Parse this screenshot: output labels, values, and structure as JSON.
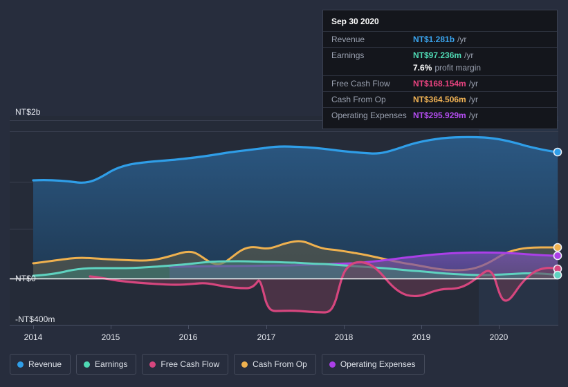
{
  "axis": {
    "y_top_label": "NT$2b",
    "y_zero_label": "NT$0",
    "y_bottom_label": "-NT$400m",
    "x_ticks": [
      "2014",
      "2015",
      "2016",
      "2017",
      "2018",
      "2019",
      "2020"
    ]
  },
  "tooltip": {
    "date": "Sep 30 2020",
    "rows": [
      {
        "label": "Revenue",
        "value": "NT$1.281b",
        "unit": "/yr",
        "color": "#3aa4ee"
      },
      {
        "label": "Earnings",
        "value": "NT$97.236m",
        "unit": "/yr",
        "color": "#4fd9b4"
      },
      {
        "label": "",
        "value": "7.6%",
        "unit": "profit margin",
        "color": "#ffffff"
      },
      {
        "label": "Free Cash Flow",
        "value": "NT$168.154m",
        "unit": "/yr",
        "color": "#e8437f"
      },
      {
        "label": "Cash From Op",
        "value": "NT$364.506m",
        "unit": "/yr",
        "color": "#f0b254"
      },
      {
        "label": "Operating Expenses",
        "value": "NT$295.929m",
        "unit": "/yr",
        "color": "#b44df0"
      }
    ]
  },
  "legend": {
    "items": [
      {
        "label": "Revenue",
        "color": "#2f9ee8"
      },
      {
        "label": "Earnings",
        "color": "#4fd9b4"
      },
      {
        "label": "Free Cash Flow",
        "color": "#d6467e"
      },
      {
        "label": "Cash From Op",
        "color": "#efb14f"
      },
      {
        "label": "Operating Expenses",
        "color": "#ab3fe8"
      }
    ]
  },
  "colors": {
    "background": "#272d3d",
    "plot_background": "#252b38",
    "gridline": "#3a4050",
    "zero_line": "#ffffff"
  },
  "chart_data": {
    "type": "area",
    "title": "",
    "xlabel": "",
    "ylabel": "",
    "ylim": [
      -400,
      2000
    ],
    "y_unit": "NT$ millions",
    "x": [
      "2014",
      "2014.25",
      "2014.5",
      "2014.75",
      "2015",
      "2015.25",
      "2015.5",
      "2015.75",
      "2016",
      "2016.25",
      "2016.5",
      "2016.75",
      "2017",
      "2017.25",
      "2017.5",
      "2017.75",
      "2018",
      "2018.25",
      "2018.5",
      "2018.75",
      "2019",
      "2019.25",
      "2019.5",
      "2019.75",
      "2020",
      "2020.25",
      "2020.5",
      "2020.75"
    ],
    "grid": true,
    "legend_position": "bottom",
    "series": [
      {
        "name": "Revenue",
        "color": "#2f9ee8",
        "fill": "#22405e",
        "values": [
          1175,
          1180,
          1160,
          1120,
          1130,
          1190,
          1250,
          1290,
          1300,
          1300,
          1310,
          1320,
          1360,
          1390,
          1390,
          1370,
          1385,
          1390,
          1380,
          1360,
          1380,
          1430,
          1480,
          1520,
          1540,
          1520,
          1460,
          1281
        ]
      },
      {
        "name": "Earnings",
        "color": "#4fd9b4",
        "fill": "#3b6f69",
        "values": [
          20,
          25,
          55,
          60,
          60,
          58,
          58,
          60,
          75,
          90,
          100,
          100,
          100,
          102,
          98,
          95,
          92,
          88,
          82,
          78,
          70,
          62,
          55,
          52,
          58,
          72,
          85,
          97
        ]
      },
      {
        "name": "Free Cash Flow",
        "color": "#d6467e",
        "fill": "#6a3a52",
        "values": [
          null,
          null,
          25,
          10,
          -10,
          -18,
          -20,
          -22,
          -35,
          -45,
          110,
          150,
          -300,
          -305,
          -310,
          -312,
          -310,
          90,
          100,
          60,
          30,
          35,
          100,
          175,
          45,
          -180,
          -40,
          168
        ]
      },
      {
        "name": "Cash From Op",
        "color": "#efb14f",
        "fill": "#5c5a49",
        "values": [
          255,
          270,
          290,
          300,
          300,
          295,
          290,
          285,
          290,
          330,
          350,
          300,
          255,
          320,
          370,
          390,
          375,
          395,
          430,
          400,
          370,
          360,
          345,
          320,
          290,
          250,
          320,
          364
        ]
      },
      {
        "name": "Operating Expenses",
        "color": "#ab3fe8",
        "fill": "#57406e",
        "values": [
          null,
          null,
          null,
          null,
          null,
          null,
          null,
          140,
          142,
          145,
          148,
          150,
          152,
          155,
          158,
          160,
          162,
          168,
          178,
          195,
          215,
          235,
          255,
          268,
          280,
          288,
          292,
          296
        ]
      }
    ],
    "highlight_band": {
      "from": "2019.85",
      "to": "2020.75"
    },
    "endpoint_markers": true
  }
}
